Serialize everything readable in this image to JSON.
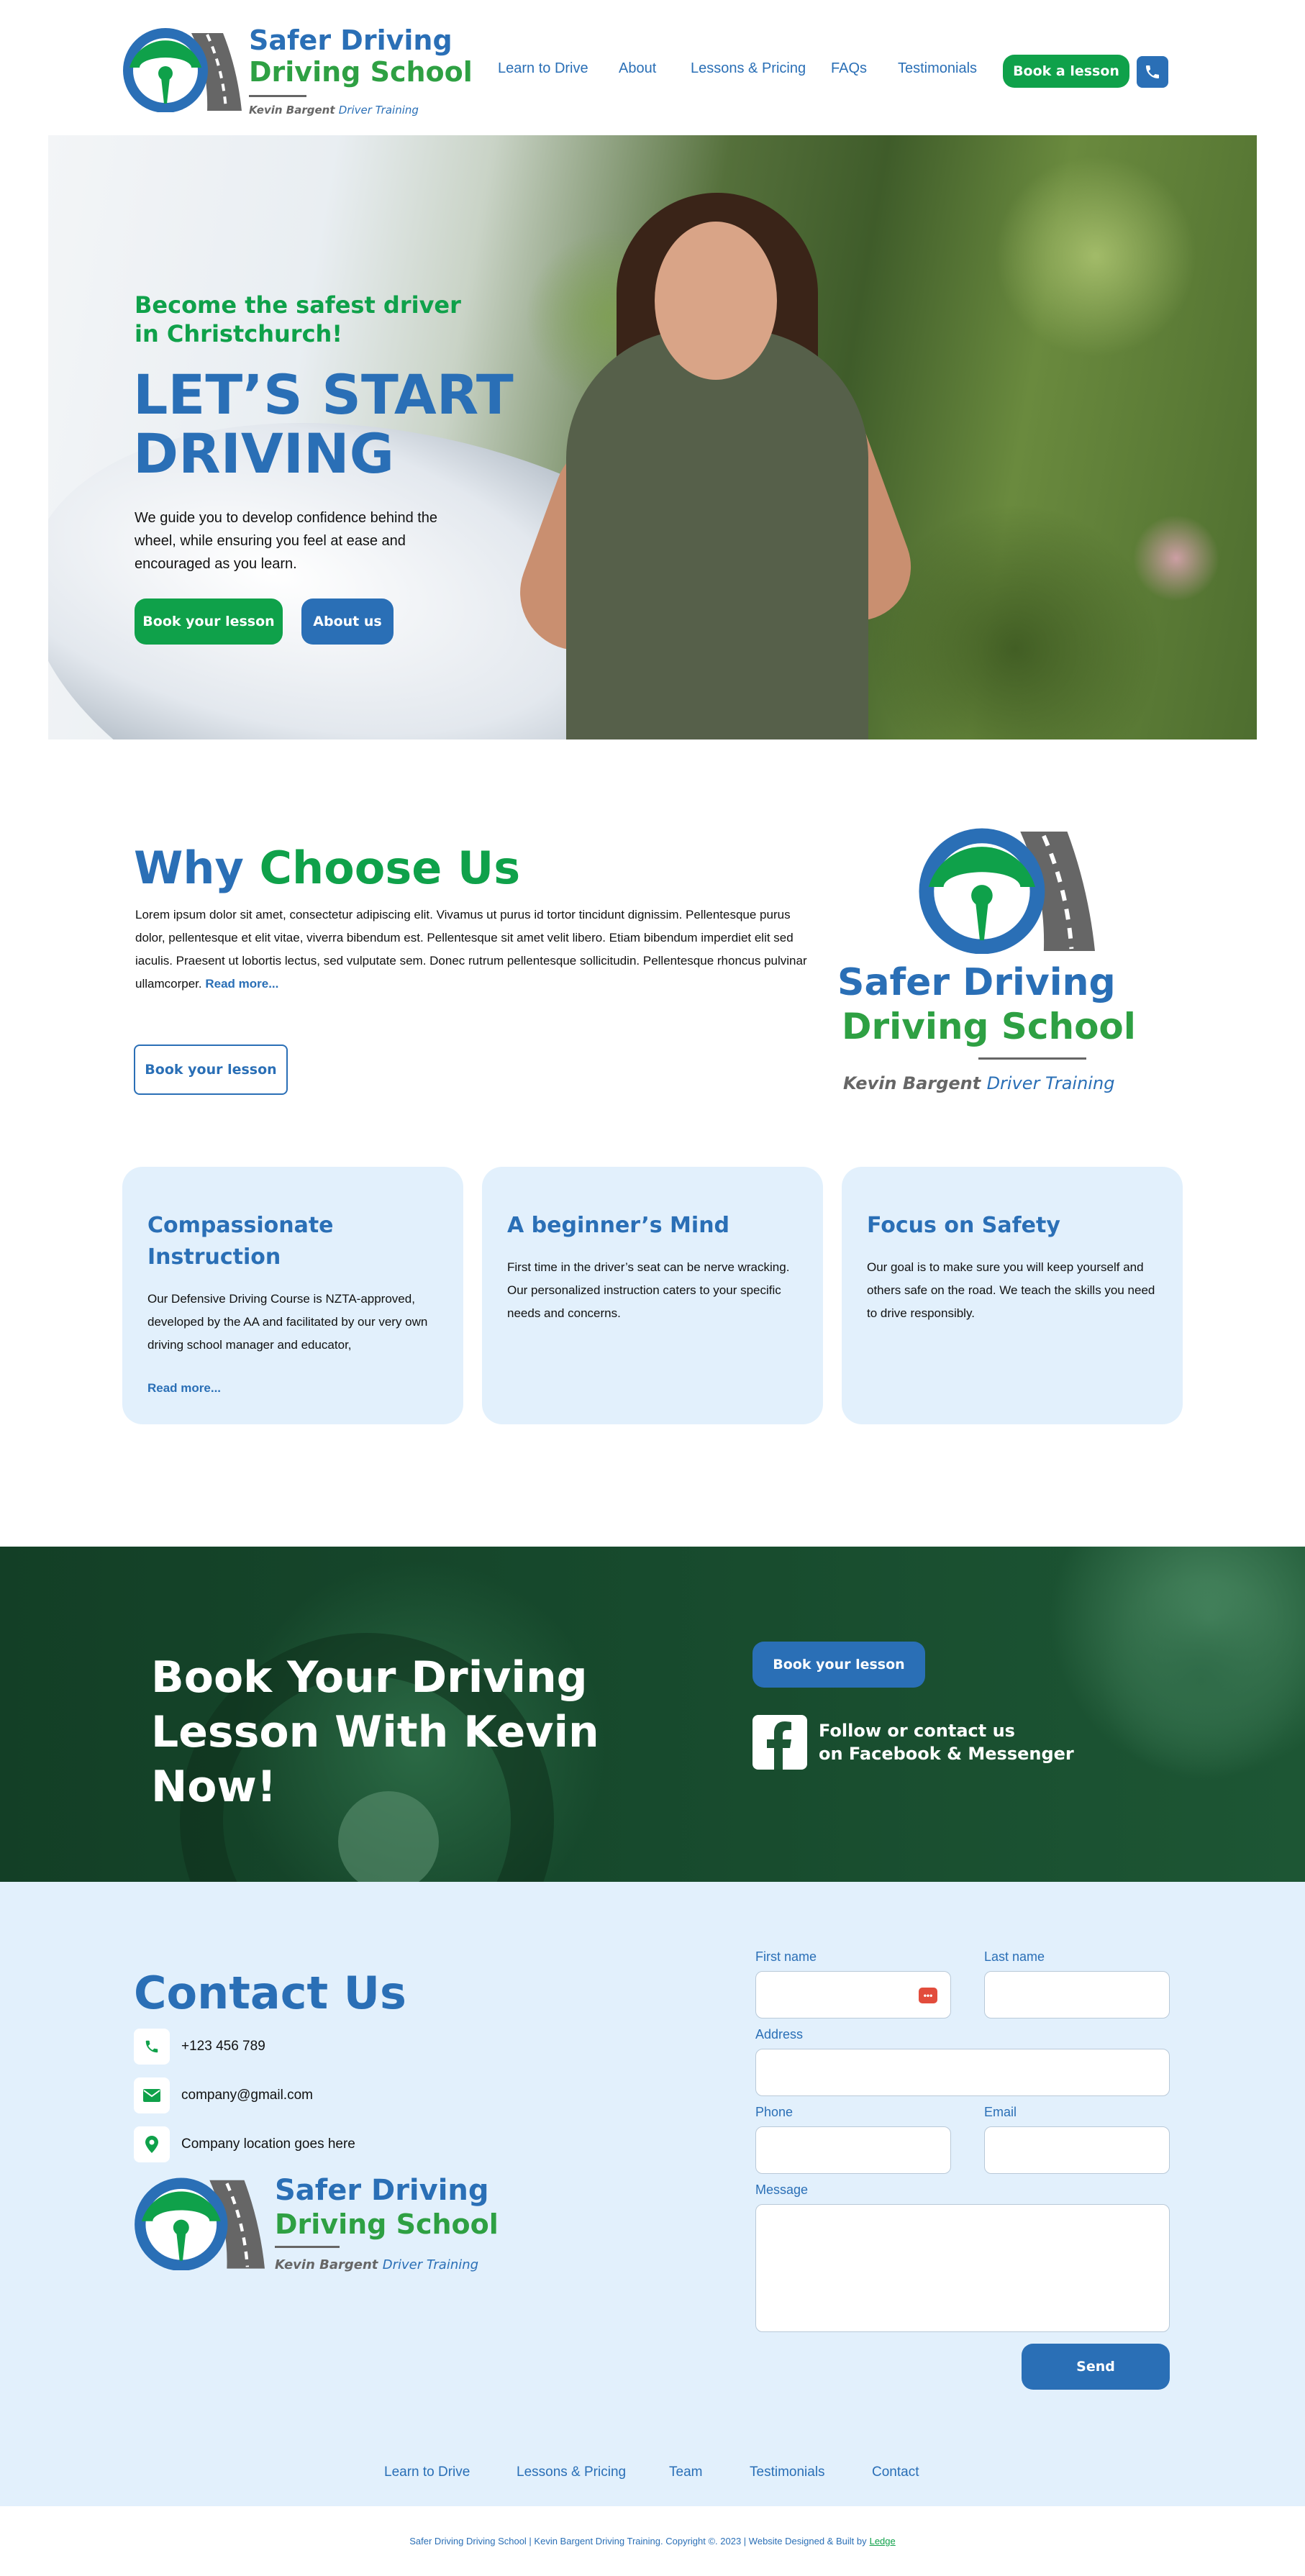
{
  "brand": {
    "name_line1": "Safer Driving",
    "name_line2": "Driving School",
    "tagline_person": "Kevin Bargent",
    "tagline_rest": "Driver Training",
    "colors": {
      "blue": "#2a6fb6",
      "green": "#0fa14a",
      "road": "#666666"
    }
  },
  "nav": {
    "items": [
      "Learn to Drive",
      "About",
      "Lessons & Pricing",
      "FAQs",
      "Testimonials"
    ],
    "cta_label": "Book a lesson",
    "phone_icon": "phone-icon"
  },
  "hero": {
    "eyebrow": "Become the safest driver in Christchurch!",
    "title": "LET’S START DRIVING",
    "body": "We guide you to develop confidence behind the wheel, while ensuring you feel at ease and encouraged as you learn.",
    "primary_button": "Book your lesson",
    "secondary_button": "About us"
  },
  "why": {
    "title_part1": "Why",
    "title_part2": "Choose Us",
    "body": "Lorem ipsum dolor sit amet, consectetur adipiscing elit. Vivamus ut purus id tortor tincidunt dignissim. Pellentesque purus dolor, pellentesque et elit vitae, viverra bibendum est. Pellentesque sit amet velit libero. Etiam bibendum imperdiet elit sed iaculis. Praesent ut lobortis lectus, sed vulputate sem. Donec rutrum pellentesque sollicitudin. Pellentesque rhoncus pulvinar ullamcorper.",
    "read_more": "Read more...",
    "button": "Book your lesson"
  },
  "cards": [
    {
      "title": "Compassionate Instruction",
      "body": "Our Defensive Driving Course is NZTA-approved, developed by the AA and facilitated by our very own driving school manager and educator,",
      "link": "Read more..."
    },
    {
      "title": "A beginner’s Mind",
      "body": "First time in the driver’s seat can be nerve wracking.  Our personalized instruction caters to your specific needs and concerns."
    },
    {
      "title": "Focus on Safety",
      "body": "Our goal is to make sure you will keep yourself and others safe on the road. We teach the skills you need to drive responsibly."
    }
  ],
  "cta": {
    "title": "Book Your Driving Lesson With Kevin Now!",
    "button": "Book your lesson",
    "social_line1": "Follow or contact us",
    "social_line2": "on Facebook & Messenger",
    "social_icon": "facebook-icon"
  },
  "contact": {
    "title": "Contact Us",
    "phone": "+123 456 789",
    "email": "company@gmail.com",
    "location": "Company location goes here",
    "form": {
      "first_name": "First name",
      "last_name": "Last name",
      "address": "Address",
      "phone": "Phone",
      "email": "Email",
      "message": "Message",
      "submit": "Send"
    }
  },
  "footer": {
    "links": [
      "Learn to Drive",
      "Lessons & Pricing",
      "Team",
      "Testimonials",
      "Contact"
    ],
    "copyright": "Safer Driving Driving School | Kevin Bargent Driving Training. Copyright ©. 2023  | Website Designed & Built by",
    "builder": "Ledge"
  }
}
